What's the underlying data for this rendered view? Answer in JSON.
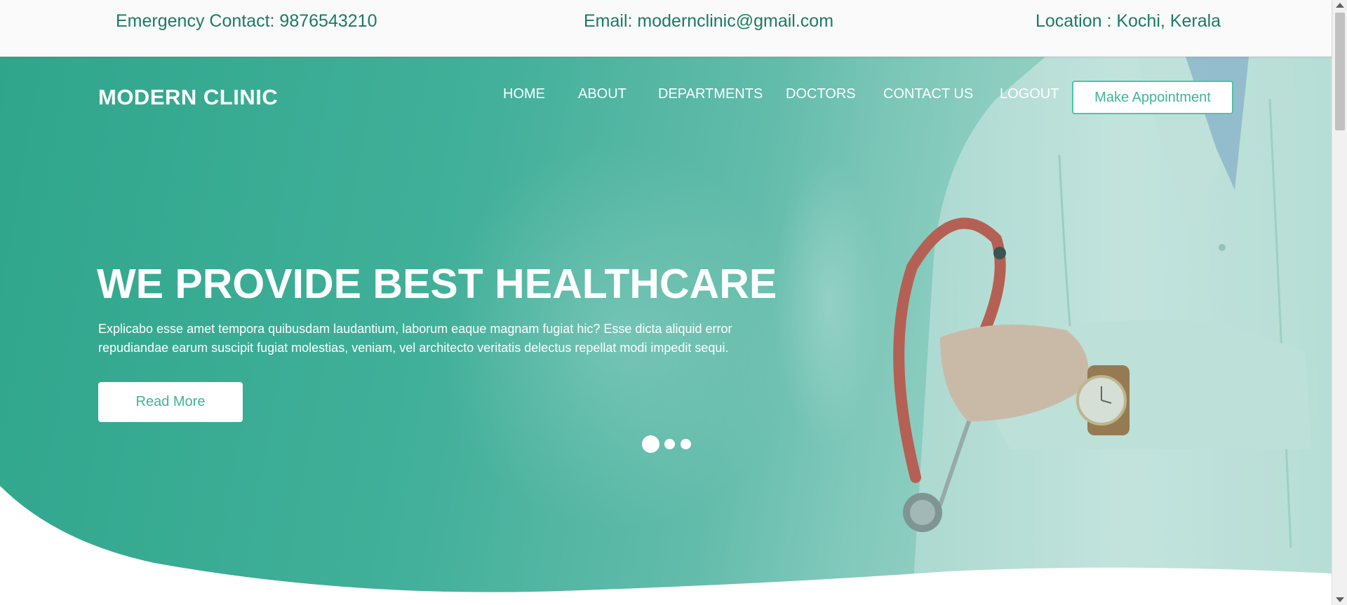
{
  "topbar": {
    "emergency": "Emergency Contact: 9876543210",
    "email": "Email: modernclinic@gmail.com",
    "location": "Location : Kochi, Kerala"
  },
  "brand": "MODERN CLINIC",
  "nav": {
    "items": [
      "HOME",
      "ABOUT",
      "DEPARTMENTS",
      "DOCTORS",
      "CONTACT US",
      "LOGOUT"
    ],
    "cta": "Make Appointment"
  },
  "hero": {
    "title": "WE PROVIDE BEST HEALTHCARE",
    "text": "Explicabo esse amet tempora quibusdam laudantium, laborum eaque magnam fugiat hic? Esse dicta aliquid error repudiandae earum suscipit fugiat molestias, veniam, vel architecto veritatis delectus repellat modi impedit sequi.",
    "button": "Read More",
    "slides": 3,
    "active_slide": 1
  },
  "colors": {
    "brand": "#2fa68c",
    "accent": "#4cc5a6",
    "topbar_text": "#1a7a64"
  }
}
